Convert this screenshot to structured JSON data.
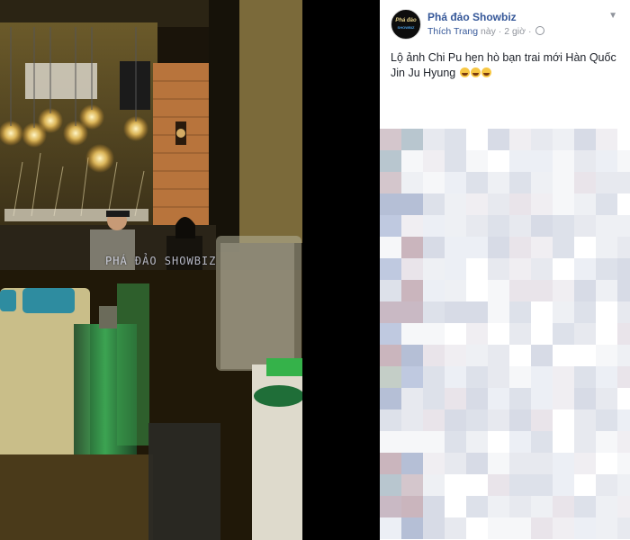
{
  "post": {
    "page_name": "Phá đảo Showbiz",
    "like_label": "Thích Trang",
    "time_label": "này · 2 giờ ·",
    "text": "Lộ ảnh Chi Pu hẹn hò bạn trai mới Hàn Quốc Jin Ju Hyung",
    "emoji_count": 3
  },
  "avatar": {
    "line1": "Phá đảo",
    "line2": "SHOWBIZ"
  },
  "photo": {
    "watermark": "PHÁ ĐẢO SHOWBIZ"
  },
  "colors": {
    "link": "#365899",
    "meta": "#90949c",
    "text": "#1d2129",
    "viewer_bg": "#000000"
  },
  "icons": {
    "globe": "globe-icon",
    "menu": "chevron-down-icon",
    "emoji": "laughing-emoji-icon"
  }
}
